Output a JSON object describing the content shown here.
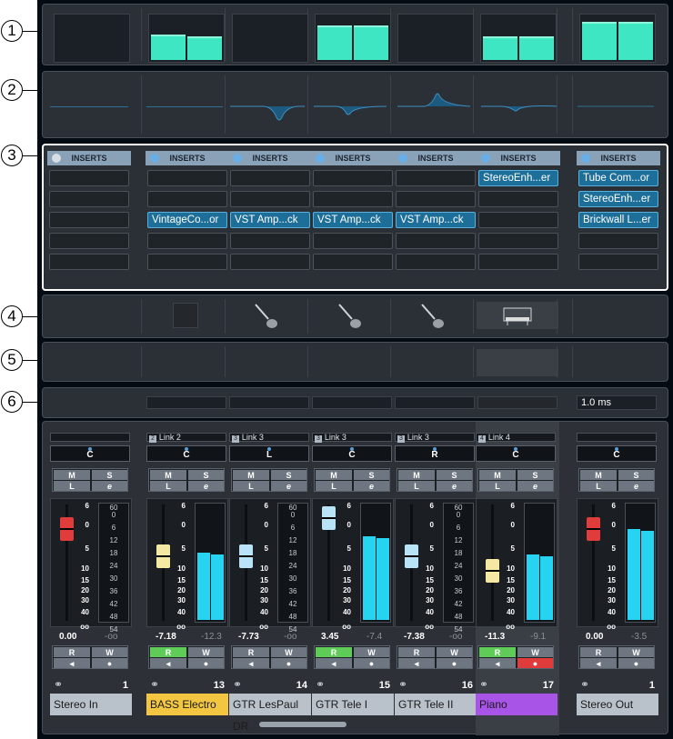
{
  "callouts": [
    "1",
    "2",
    "3",
    "4",
    "5",
    "6"
  ],
  "inserts": {
    "header": "INSERTS",
    "channels": [
      {
        "slots": [
          "",
          "",
          "",
          "",
          ""
        ]
      },
      {
        "slots": [
          "",
          "",
          "VintageCo...or",
          "",
          ""
        ]
      },
      {
        "slots": [
          "",
          "",
          "VST Amp...ck",
          "",
          ""
        ]
      },
      {
        "slots": [
          "",
          "",
          "VST Amp...ck",
          "",
          ""
        ]
      },
      {
        "slots": [
          "",
          "",
          "VST Amp...ck",
          "",
          ""
        ]
      },
      {
        "slots": [
          "StereoEnh...er",
          "",
          "",
          "",
          ""
        ]
      },
      {
        "slots": [
          "Tube Com...or",
          "StereoEnh...er",
          "Brickwall L...er",
          "",
          ""
        ]
      }
    ]
  },
  "latency": {
    "value": "1.0 ms"
  },
  "channels": [
    {
      "link": "",
      "link_num": "",
      "pan": "C",
      "volume": "0.00",
      "peak": "-oo",
      "number": "1",
      "name": "Stereo In",
      "name_color": "#b9c2cb",
      "meter": 0,
      "fader_color": "#e03c3c",
      "rw_active": false
    },
    {
      "link": "Link 2",
      "link_num": "2",
      "pan": "C",
      "volume": "-7.18",
      "peak": "-12.3",
      "number": "13",
      "name": "BASS Electro",
      "name_color": "#f2c640",
      "meter": 0.58,
      "fader_color": "#f4e8a2",
      "rw_active": true
    },
    {
      "link": "Link 3",
      "link_num": "3",
      "pan": "L",
      "volume": "-7.73",
      "peak": "-oo",
      "number": "14",
      "name": "GTR LesPaul DR",
      "name_color": "#b9c2cb",
      "meter": 0,
      "fader_color": "#b9e4f8",
      "rw_active": false
    },
    {
      "link": "Link 3",
      "link_num": "3",
      "pan": "C",
      "volume": "3.45",
      "peak": "-7.4",
      "number": "15",
      "name": "GTR Tele I",
      "name_color": "#b9c2cb",
      "meter": 0.72,
      "fader_color": "#b9e4f8",
      "rw_active": true
    },
    {
      "link": "Link 3",
      "link_num": "3",
      "pan": "R",
      "volume": "-7.38",
      "peak": "-oo",
      "number": "16",
      "name": "GTR Tele II",
      "name_color": "#b9c2cb",
      "meter": 0,
      "fader_color": "#b9e4f8",
      "rw_active": false
    },
    {
      "link": "Link 4",
      "link_num": "4",
      "pan": "C",
      "volume": "-11.3",
      "peak": "-9.1",
      "number": "17",
      "name": "Piano",
      "name_color": "#a854e6",
      "meter": 0.56,
      "fader_color": "#f4e8a2",
      "rw_active": true
    },
    {
      "link": "",
      "link_num": "",
      "pan": "C",
      "volume": "0.00",
      "peak": "-3.5",
      "number": "1",
      "name": "Stereo Out",
      "name_color": "#b9c2cb",
      "meter": 0.78,
      "fader_color": "#e03c3c",
      "rw_active": false
    }
  ],
  "buttons": {
    "mute": "M",
    "solo": "S",
    "listen": "L",
    "edit": "e",
    "read": "R",
    "write": "W"
  },
  "fader_scale": [
    "6",
    "0",
    "5",
    "10",
    "15",
    "20",
    "30",
    "40",
    "oo"
  ],
  "meter_scale": [
    "0",
    "6",
    "12",
    "18",
    "24",
    "30",
    "36",
    "42",
    "48",
    "54",
    "60"
  ],
  "colors": {
    "meter": "#26d4f2",
    "plugin": "#1d6e98",
    "read_on": "#5fcc58",
    "write_on": "#e03c3c"
  }
}
